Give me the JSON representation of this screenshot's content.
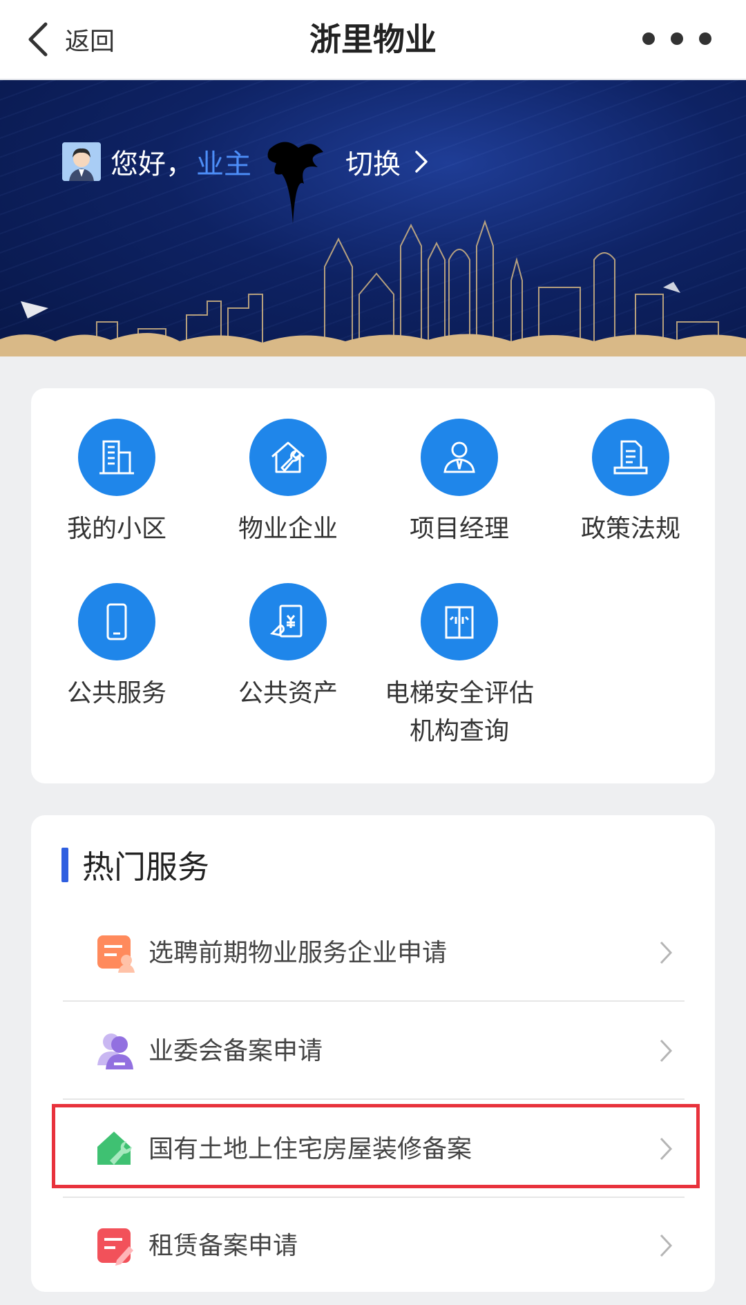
{
  "navbar": {
    "back_label": "返回",
    "title": "浙里物业"
  },
  "banner": {
    "greeting": "您好，",
    "user_role": "业主",
    "switch_label": "切换"
  },
  "services": [
    {
      "label": "我的小区",
      "icon": "building-icon"
    },
    {
      "label": "物业企业",
      "icon": "house-wrench-icon"
    },
    {
      "label": "项目经理",
      "icon": "manager-icon"
    },
    {
      "label": "政策法规",
      "icon": "document-icon"
    },
    {
      "label": "公共服务",
      "icon": "phone-icon"
    },
    {
      "label": "公共资产",
      "icon": "asset-icon"
    },
    {
      "label": "电梯安全评估机构查询",
      "line1": "电梯安全评估",
      "line2": "机构查询",
      "icon": "elevator-icon"
    }
  ],
  "hot": {
    "title": "热门服务",
    "items": [
      {
        "label": "选聘前期物业服务企业申请",
        "icon": "orange-form-icon"
      },
      {
        "label": "业委会备案申请",
        "icon": "purple-user-icon"
      },
      {
        "label": "国有土地上住宅房屋装修备案",
        "icon": "green-house-icon"
      },
      {
        "label": "租赁备案申请",
        "icon": "red-edit-icon"
      }
    ]
  },
  "colors": {
    "accent": "#1f86ea",
    "title_bar": "#2f5fe0",
    "highlight": "#e8323c",
    "user_role": "#4d8ef8"
  }
}
